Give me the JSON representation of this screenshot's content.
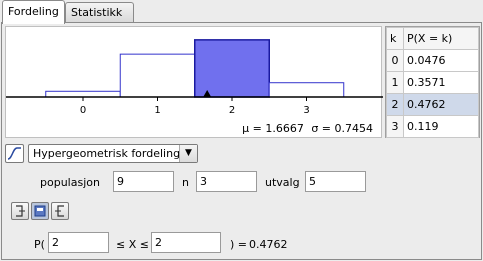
{
  "tabs": [
    {
      "label": "Fordeling",
      "active": true
    },
    {
      "label": "Statistikk",
      "active": false
    }
  ],
  "chart_data": {
    "type": "bar",
    "categories": [
      "0",
      "1",
      "2",
      "3"
    ],
    "values": [
      0.0476,
      0.3571,
      0.4762,
      0.119
    ],
    "highlight_index": 2,
    "highlight_color": "#7070ee",
    "outline_color": "#3333cc",
    "mean_marker": 1.6667,
    "xlim": [
      -1,
      4
    ],
    "ylim": [
      0,
      0.5
    ]
  },
  "stats": {
    "mu_label": "μ = 1.6667",
    "sigma_label": "σ = 0.7454"
  },
  "table": {
    "headers": [
      "k",
      "P(X = k)"
    ],
    "rows": [
      {
        "k": "0",
        "p": "0.0476"
      },
      {
        "k": "1",
        "p": "0.3571"
      },
      {
        "k": "2",
        "p": "0.4762"
      },
      {
        "k": "3",
        "p": "0.119"
      }
    ],
    "selected_row": 2
  },
  "distribution": {
    "selected": "Hypergeometrisk fordeling",
    "curve_icon": "curve-icon",
    "dropdown_icon": "chevron-down-icon"
  },
  "params": {
    "populasjon_label": "populasjon",
    "populasjon_value": "9",
    "n_label": "n",
    "n_value": "3",
    "utvalg_label": "utvalg",
    "utvalg_value": "5"
  },
  "interval_buttons": [
    {
      "icon": "left-bound-icon"
    },
    {
      "icon": "interval-icon"
    },
    {
      "icon": "right-bound-icon"
    }
  ],
  "probability": {
    "prefix": "P(",
    "low_value": "2",
    "middle": "≤ X ≤",
    "high_value": "2",
    "suffix": ") =",
    "result": "0.4762"
  }
}
